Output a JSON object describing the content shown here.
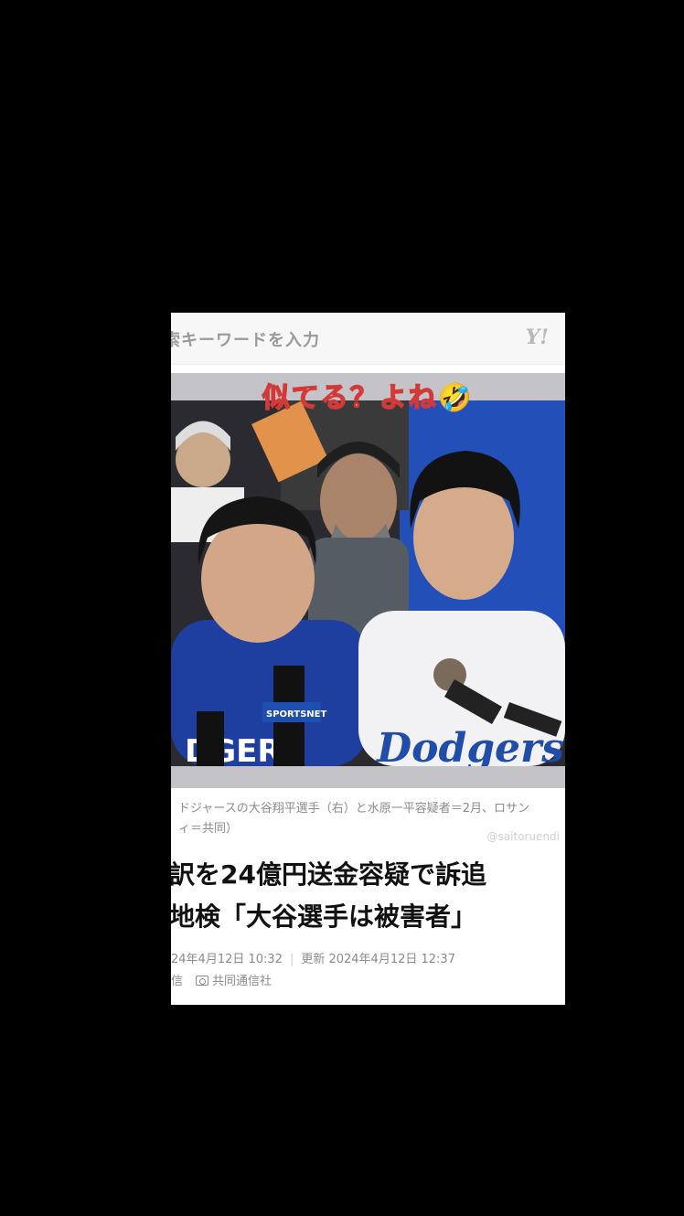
{
  "search": {
    "placeholder": "索キーワードを入力"
  },
  "brand": {
    "logo": "Y!"
  },
  "overlay": {
    "text": "似てる？よね🤣"
  },
  "photo": {
    "jersey_text": "Dodgers",
    "hoodie_text": "DGERS",
    "mic_flag": "SPORTSNET"
  },
  "caption": {
    "line1": "ドジャースの大谷翔平選手（右）と水原一平容疑者＝2月、ロサン",
    "line2": "ィ＝共同）"
  },
  "watermark": "@saitoruendi",
  "headline": {
    "line1": "訳を24億円送金容疑で訴追",
    "line2": "地検「大谷選手は被害者」"
  },
  "meta": {
    "published": "24年4月12日 10:32",
    "updated": "更新 2024年4月12日 12:37",
    "category": "信",
    "source": "共同通信社"
  }
}
